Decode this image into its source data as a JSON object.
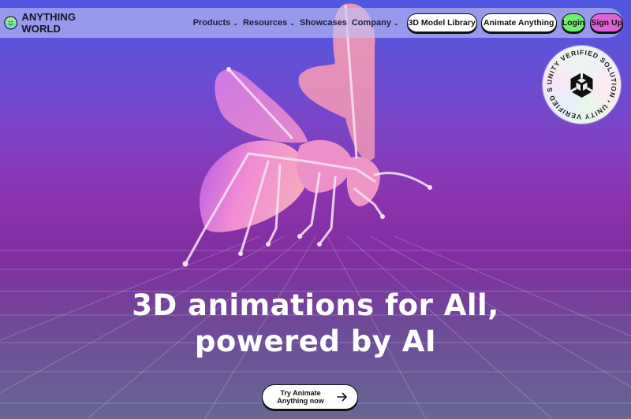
{
  "brand": {
    "name": "ANYTHING WORLD",
    "logo_icon": "smiling-globe-icon"
  },
  "nav": {
    "menu": [
      {
        "label": "Products",
        "has_dropdown": true
      },
      {
        "label": "Resources",
        "has_dropdown": true
      },
      {
        "label": "Showcases",
        "has_dropdown": false
      },
      {
        "label": "Company",
        "has_dropdown": true
      }
    ],
    "dropdown_icon": "chevron-down-icon",
    "buttons": {
      "model_library": "3D Model Library",
      "animate_anything": "Animate Anything",
      "login": "Login",
      "signup": "Sign Up"
    }
  },
  "badge": {
    "text": "UNITY VERIFIED SOLUTION › UNITY VERIFIED SOLUTION ›",
    "icon": "unity-logo-icon"
  },
  "hero": {
    "headline_line1": "3D animations for All,",
    "headline_line2": "powered by AI",
    "image": "rigged-3d-bee-model",
    "cta_line1": "Try Animate",
    "cta_line2": "Anything now",
    "cta_icon": "arrow-right-icon"
  },
  "colors": {
    "login_button": "#6df06f",
    "signup_button": "#e160d8",
    "background_top": "#4f57e0",
    "background_mid": "#8c32ae",
    "background_bottom": "#676792"
  }
}
